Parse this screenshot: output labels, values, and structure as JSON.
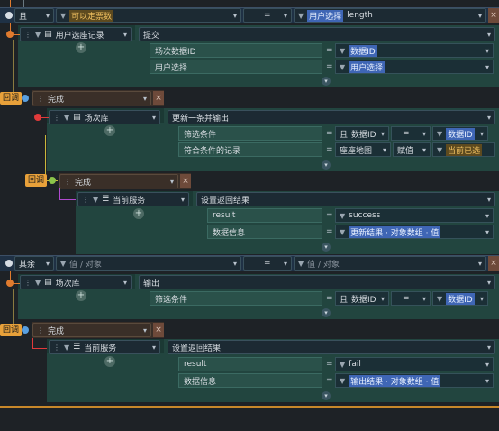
{
  "cond1": {
    "left_op": "且",
    "subject": "可以定票数",
    "compare": "=",
    "func_target": "用户选择",
    "func_name": "length"
  },
  "block_submit": {
    "title": "用户选座记录",
    "action": "提交",
    "rows": [
      {
        "label": "场次数据ID",
        "value": "数据ID"
      },
      {
        "label": "用户选择",
        "value": "用户选择"
      }
    ]
  },
  "callback1": {
    "badge": "回调",
    "title": "完成"
  },
  "block_update": {
    "title": "场次库",
    "action": "更新一条并输出",
    "row1": {
      "label": "筛选条件",
      "op": "且",
      "field": "数据ID",
      "cmp": "=",
      "value": "数据ID"
    },
    "row2": {
      "label": "符合条件的记录",
      "source": "座座地图",
      "mode": "赋值",
      "value": "当前已选"
    }
  },
  "callback2": {
    "badge": "回调",
    "title": "完成"
  },
  "block_service1": {
    "title": "当前服务",
    "action": "设置返回结果",
    "rows": [
      {
        "label": "result",
        "value": "success"
      },
      {
        "label": "数据信息",
        "value": "更新结果 · 对象数组 · 值"
      }
    ]
  },
  "else_row": {
    "label": "其余",
    "placeholder1": "值 / 对象",
    "compare": "=",
    "placeholder2": "值 / 对象"
  },
  "block_output": {
    "title": "场次库",
    "action": "输出",
    "row1": {
      "label": "筛选条件",
      "op": "且",
      "field": "数据ID",
      "cmp": "=",
      "value": "数据ID"
    }
  },
  "callback3": {
    "badge": "回调",
    "title": "完成"
  },
  "block_service2": {
    "title": "当前服务",
    "action": "设置返回结果",
    "rows": [
      {
        "label": "result",
        "value": "fail"
      },
      {
        "label": "数据信息",
        "value": "输出结果 · 对象数组 · 值"
      }
    ]
  },
  "eq_sign": "=",
  "plus_sign": "+",
  "close_sign": "×"
}
